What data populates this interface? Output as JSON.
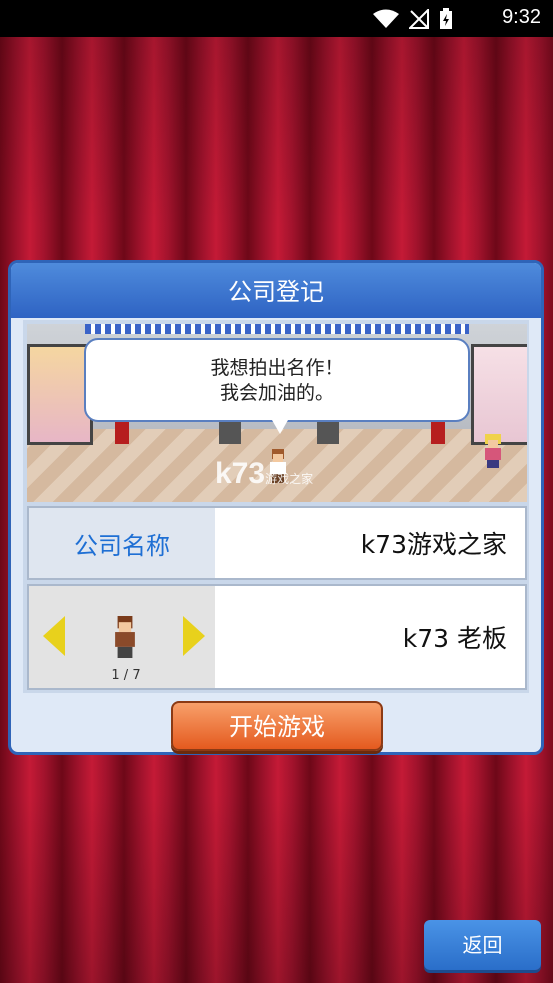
{
  "status_bar": {
    "time": "9:32"
  },
  "dialog": {
    "title": "公司登记",
    "speech_line1": "我想拍出名作！",
    "speech_line2": "我会加油的。",
    "watermark": "k73",
    "watermark_sub": "游戏之家",
    "company_label": "公司名称",
    "company_value": "k73游戏之家",
    "president_value": "k73 老板",
    "avatar_counter": "1 / 7",
    "start_button": "开始游戏"
  },
  "back_button": "返回"
}
